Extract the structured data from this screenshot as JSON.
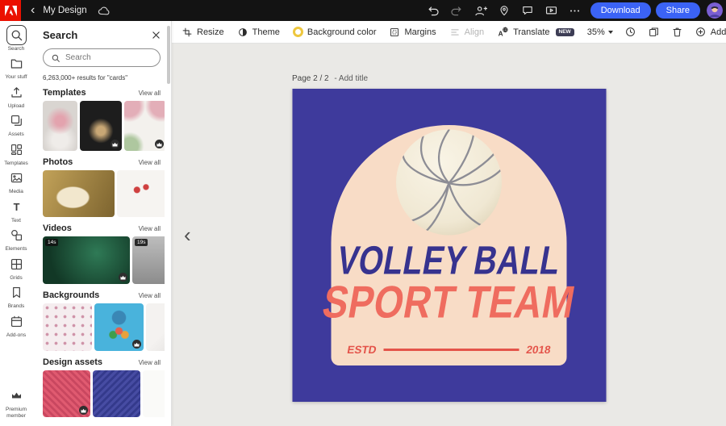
{
  "header": {
    "title": "My Design",
    "download_label": "Download",
    "share_label": "Share",
    "accent_color": "#3b63f6"
  },
  "rail": {
    "items": [
      {
        "label": "Search"
      },
      {
        "label": "Your stuff"
      },
      {
        "label": "Upload"
      },
      {
        "label": "Assets"
      },
      {
        "label": "Templates"
      },
      {
        "label": "Media"
      },
      {
        "label": "Text"
      },
      {
        "label": "Elements"
      },
      {
        "label": "Grids"
      },
      {
        "label": "Brands"
      },
      {
        "label": "Add-ons"
      }
    ],
    "footer": {
      "label": "Premium member"
    }
  },
  "panel": {
    "title": "Search",
    "search_placeholder": "Search",
    "results_text": "6,263,000+ results for \"cards\"",
    "view_all": "View all",
    "sections": [
      {
        "title": "Templates"
      },
      {
        "title": "Photos"
      },
      {
        "title": "Videos"
      },
      {
        "title": "Backgrounds"
      },
      {
        "title": "Design assets"
      }
    ],
    "video_durations": [
      "14s",
      "19s"
    ]
  },
  "toolbar": {
    "resize_label": "Resize",
    "theme_label": "Theme",
    "background_color_label": "Background color",
    "margins_label": "Margins",
    "align_label": "Align",
    "translate_label": "Translate",
    "new_badge": "NEW",
    "zoom_level": "35%",
    "add_label": "Add"
  },
  "canvas": {
    "page_indicator": "Page 2 / 2",
    "page_title_hint": "- Add title",
    "design": {
      "title_line1": "VOLLEY BALL",
      "title_line2": "SPORT TEAM",
      "estd_label": "ESTD",
      "year": "2018",
      "background_color": "#3e3a9c",
      "arch_color": "#f8dcc6",
      "title1_color": "#37338f",
      "title2_color": "#ef6c5f",
      "estd_color": "#e4544a"
    }
  }
}
